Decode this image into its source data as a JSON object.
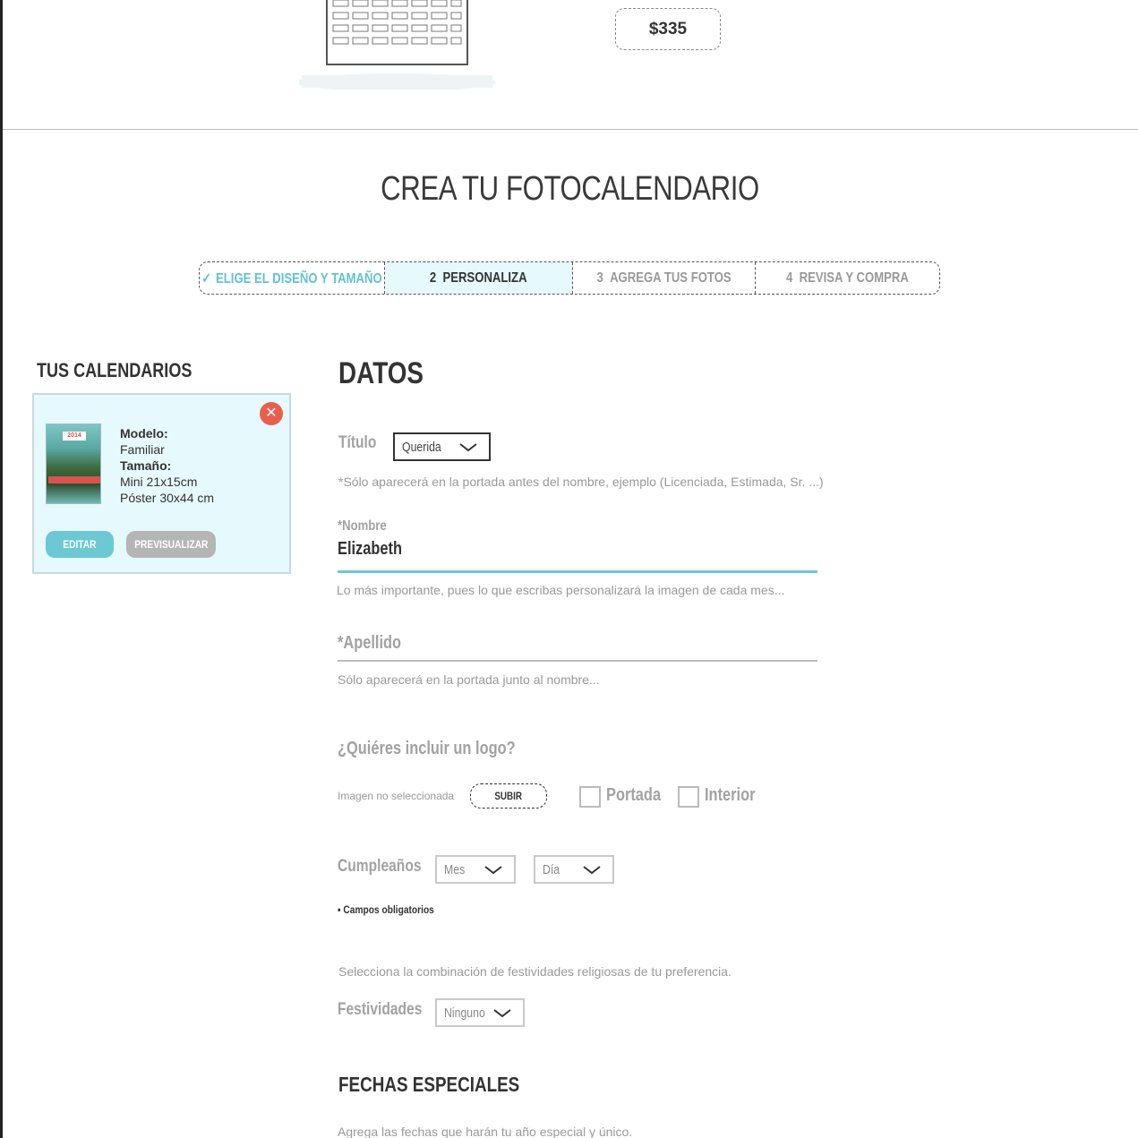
{
  "header": {
    "price": "$335"
  },
  "page": {
    "title": "CREA TU FOTOCALENDARIO"
  },
  "steps": [
    {
      "number": "",
      "label": "ELIGE EL DISEÑO Y TAMAÑO",
      "status": "done"
    },
    {
      "number": "2",
      "label": "PERSONALIZA",
      "status": "active"
    },
    {
      "number": "3",
      "label": "AGREGA TUS FOTOS",
      "status": "pending"
    },
    {
      "number": "4",
      "label": "REVISA Y COMPRA",
      "status": "pending"
    }
  ],
  "sidebar": {
    "title": "TUS CALENDARIOS",
    "card": {
      "model_label": "Modelo:",
      "model_value": "Familiar",
      "size_label": "Tamaño:",
      "size_value_1": "Mini 21x15cm",
      "size_value_2": "Póster 30x44 cm",
      "thumb_year": "2014",
      "edit_label": "EDITAR",
      "preview_label": "PREVISUALIZAR",
      "close_icon": "close-icon"
    }
  },
  "form": {
    "section_title": "DATOS",
    "titulo_label": "Título",
    "titulo_value": "Querida",
    "titulo_hint": "*Sólo aparecerá en la portada antes del nombre, ejemplo (Licenciada, Estimada, Sr. ...)",
    "nombre_label": "*Nombre",
    "nombre_value": "Elizabeth",
    "nombre_hint": "Lo más importante, pues lo que escribas personalizará la imagen de cada mes...",
    "apellido_placeholder": "*Apellido",
    "apellido_hint": "Sólo aparecerá en la portada junto al nombre...",
    "logo_question": "¿Quiéres incluir un logo?",
    "logo_no_image": "Imagen no seleccionada",
    "logo_upload": "SUBIR",
    "logo_option_cover": "Portada",
    "logo_option_interior": "Interior",
    "birthday_label": "Cumpleaños",
    "birthday_month": "Mes",
    "birthday_day": "Día",
    "required_note": "• Campos obligatorios",
    "festivities_hint": "Selecciona la combinación de festividades religiosas de tu preferencia.",
    "festivities_label": "Festividades",
    "festivities_value": "Ninguno",
    "special_dates_title": "FECHAS ESPECIALES",
    "special_dates_hint": "Agrega las fechas que harán tu año especial y único."
  },
  "colors": {
    "accent": "#6cc8d3",
    "active_step_bg": "#e6f9fb",
    "close": "#e8604c"
  }
}
